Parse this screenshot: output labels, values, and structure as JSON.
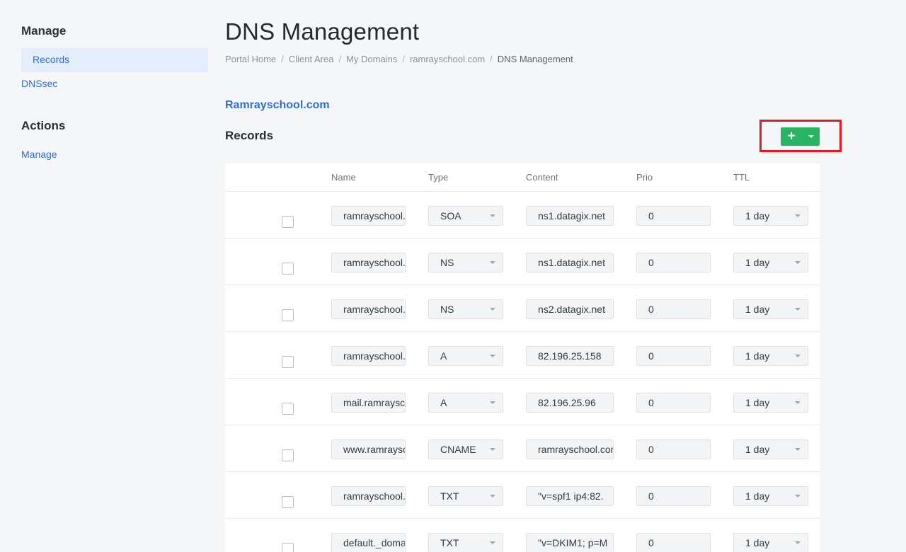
{
  "sidebar": {
    "manage_heading": "Manage",
    "items": [
      {
        "label": "Records"
      },
      {
        "label": "DNSsec"
      }
    ],
    "actions_heading": "Actions",
    "actions_items": [
      {
        "label": "Manage"
      }
    ]
  },
  "header": {
    "title": "DNS Management",
    "breadcrumb": [
      "Portal Home",
      "Client Area",
      "My Domains",
      "ramrayschool.com",
      "DNS Management"
    ]
  },
  "main": {
    "domain": "Ramrayschool.com",
    "records_heading": "Records",
    "add_button_label": "+",
    "columns": [
      "Name",
      "Type",
      "Content",
      "Prio",
      "TTL"
    ],
    "rows": [
      {
        "name": "ramrayschool.com",
        "type": "SOA",
        "content": "ns1.datagix.net",
        "prio": "0",
        "ttl": "1 day"
      },
      {
        "name": "ramrayschool.com",
        "type": "NS",
        "content": "ns1.datagix.net",
        "prio": "0",
        "ttl": "1 day"
      },
      {
        "name": "ramrayschool.com",
        "type": "NS",
        "content": "ns2.datagix.net",
        "prio": "0",
        "ttl": "1 day"
      },
      {
        "name": "ramrayschool.com",
        "type": "A",
        "content": "82.196.25.158",
        "prio": "0",
        "ttl": "1 day"
      },
      {
        "name": "mail.ramrayschool.com",
        "type": "A",
        "content": "82.196.25.96",
        "prio": "0",
        "ttl": "1 day"
      },
      {
        "name": "www.ramrayschool.com",
        "type": "CNAME",
        "content": "ramrayschool.com",
        "prio": "0",
        "ttl": "1 day"
      },
      {
        "name": "ramrayschool.com",
        "type": "TXT",
        "content": "\"v=spf1 ip4:82.",
        "prio": "0",
        "ttl": "1 day"
      },
      {
        "name": "default._domainkey",
        "type": "TXT",
        "content": "\"v=DKIM1; p=M",
        "prio": "0",
        "ttl": "1 day"
      }
    ]
  },
  "colors": {
    "accent": "#2f6fd6",
    "add_button": "#28b463",
    "highlight": "#e01b24"
  }
}
